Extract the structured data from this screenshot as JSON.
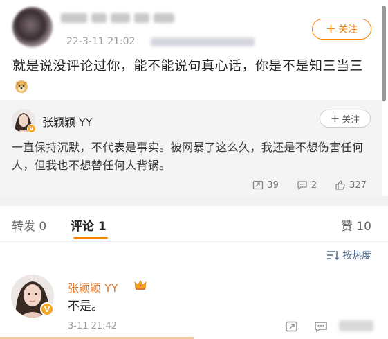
{
  "post": {
    "date": "22-3-11 21:02",
    "follow_label": "关注",
    "text": "就是说没评论过你，能不能说句真心话，你是不是知三当三",
    "emoji": "doge-emoji"
  },
  "quote": {
    "author": "张颖颖 YY",
    "follow_label": "关注",
    "text": "一直保持沉默，不代表是事实。被网暴了这么久，我还是不想伤害任何人，但我也不想替任何人背锅。",
    "reposts": "39",
    "comments": "2",
    "likes": "327"
  },
  "tabs": {
    "repost": "转发 0",
    "comment": "评论 1",
    "like": "赞 10"
  },
  "sort": {
    "label": "按热度"
  },
  "comment": {
    "author": "张颖颖 YY",
    "text": "不是。",
    "time": "3-11 21:42"
  },
  "colors": {
    "accent": "#ff8200",
    "link": "#506b8f",
    "name": "#e07a2e",
    "verified": "#f5a623"
  }
}
